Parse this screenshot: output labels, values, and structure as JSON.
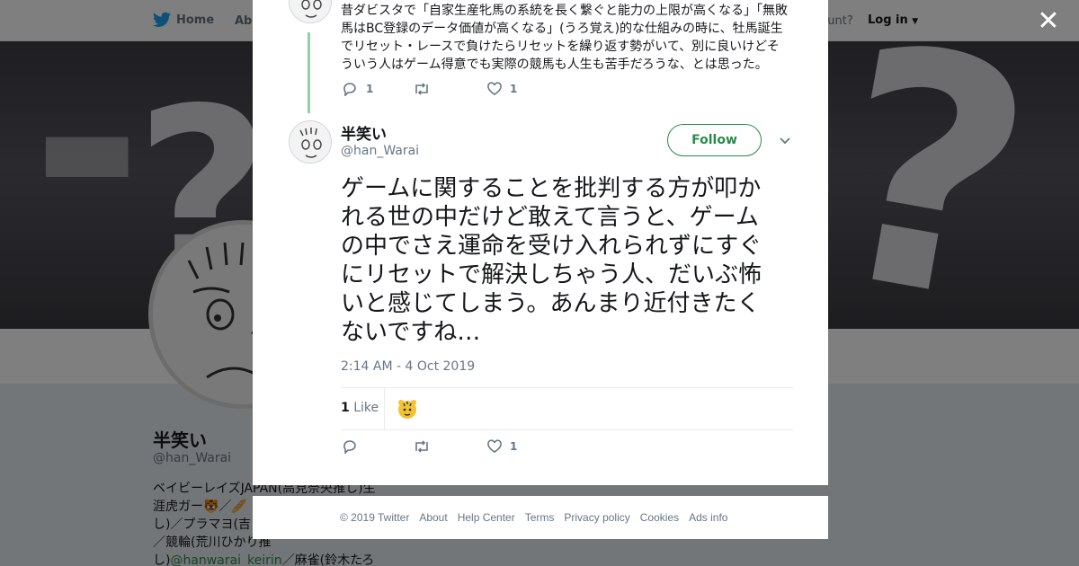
{
  "nav": {
    "home_label": "Home",
    "about_label": "Abo",
    "account_text": "ccount?",
    "login_label": "Log in"
  },
  "profile": {
    "name": "半笑い",
    "handle": "@han_Warai",
    "bio_lines": [
      "ベイビーレイズJAPAN(高見奈央推し)生",
      "涯虎ガー🐯／🥖",
      "し)／プラマヨ(吉",
      "／競輪(荒川ひかり推",
      "し)"
    ],
    "bio_link": "@hanwarai_keirin",
    "bio_tail": "／麻雀(鈴木たろう"
  },
  "ancestor_tweet": {
    "text": "昔ダビスタで「自家生産牝馬の系統を長く繋ぐと能力の上限が高くなる」「無敗馬はBC登録のデータ価値が高くなる」(うろ覚え)的な仕組みの時に、牡馬誕生でリセット・レースで負けたらリセットを繰り返す勢がいて、別に良いけどそういう人はゲーム得意でも実際の競馬も人生も苦手だろうな、とは思った。",
    "reply_count": "1",
    "like_count": "1"
  },
  "main_tweet": {
    "name": "半笑い",
    "handle": "@han_Warai",
    "follow_label": "Follow",
    "text": "ゲームに関することを批判する方が叩かれる世の中だけど敢えて言うと、ゲームの中でさえ運命を受け入れられずにすぐにリセットで解決しちゃう人、だいぶ怖いと感じてしまう。あんまり近付きたくないですね…",
    "timestamp": "2:14 AM - 4 Oct 2019",
    "likes_number": "1",
    "likes_label": "Like",
    "like_count": "1"
  },
  "footer": {
    "copyright": "© 2019 Twitter",
    "links": [
      "About",
      "Help Center",
      "Terms",
      "Privacy policy",
      "Cookies",
      "Ads info"
    ]
  },
  "colors": {
    "accent": "#2a8a4a",
    "text": "#14171a",
    "muted": "#657786"
  }
}
